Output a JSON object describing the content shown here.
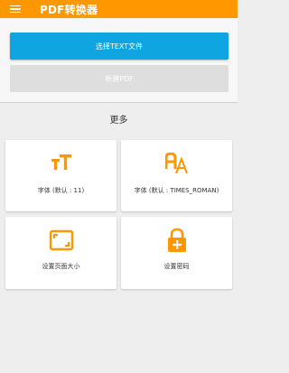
{
  "appbar": {
    "title": "PDF转换器",
    "menu_icon": "hamburger-menu-icon",
    "color": "#ff9800"
  },
  "buttons": {
    "select_text": "选择TEXT文件",
    "new_pdf": "新建PDF"
  },
  "section": {
    "title": "更多"
  },
  "cards": [
    {
      "icon": "font-size-icon",
      "label": "字体 (默认 : 11)"
    },
    {
      "icon": "font-family-icon",
      "label": "字体 (默认 : TIMES_ROMAN)"
    },
    {
      "icon": "page-size-icon",
      "label": "设置页面大小"
    },
    {
      "icon": "lock-add-icon",
      "label": "设置密码"
    }
  ],
  "colors": {
    "accent": "#ff9800",
    "primary_button": "#0ea5e0"
  }
}
